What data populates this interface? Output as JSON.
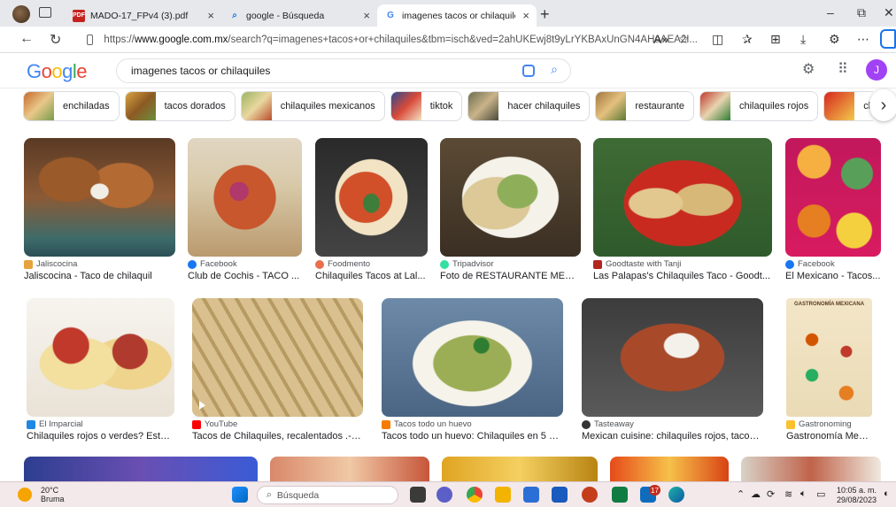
{
  "browser": {
    "tabs": [
      {
        "title": "MADO-17_FPv4 (3).pdf",
        "icon": "pdf-icon",
        "active": false
      },
      {
        "title": "google - Búsqueda",
        "icon": "search-icon",
        "active": false
      },
      {
        "title": "imagenes tacos or chilaquiles - B",
        "icon": "google-icon",
        "active": true
      }
    ],
    "url_prefix": "https://",
    "url_host": "www.google.com.mx",
    "url_rest": "/search?q=imagenes+tacos+or+chilaquiles&tbm=isch&ved=2ahUKEwj8t9yLrYKBAxUnGN4AHaAEA2I...",
    "new_tab": "+",
    "close_glyph": "×",
    "window_controls": {
      "minimize": "–",
      "restore": "⧉",
      "close": "✕"
    }
  },
  "google": {
    "logo": [
      "G",
      "o",
      "o",
      "g",
      "l",
      "e"
    ],
    "query": "imagenes tacos or chilaquiles",
    "avatar_letter": "J"
  },
  "chips": [
    {
      "label": "enchiladas"
    },
    {
      "label": "tacos dorados"
    },
    {
      "label": "chilaquiles mexicanos"
    },
    {
      "label": "tiktok"
    },
    {
      "label": "hacer chilaquiles"
    },
    {
      "label": "restaurante"
    },
    {
      "label": "chilaquiles rojos"
    },
    {
      "label": "cl"
    }
  ],
  "results_row1": [
    {
      "source": "Jaliscocina",
      "caption": "Jaliscocina - Taco de chilaquil"
    },
    {
      "source": "Facebook",
      "caption": "Club de Cochis - TACO ..."
    },
    {
      "source": "Foodmento",
      "caption": "Chilaquiles Tacos at Lal..."
    },
    {
      "source": "Tripadvisor",
      "caption": "Foto de RESTAURANTE MEXIC..."
    },
    {
      "source": "Goodtaste with Tanji",
      "caption": "Las Palapas's Chilaquiles Taco - Goodt..."
    },
    {
      "source": "Facebook",
      "caption": "El Mexicano - Tacos..."
    }
  ],
  "results_row2": [
    {
      "source": "El Imparcial",
      "caption": "Chilaquiles rojos o verdes? Esto ..."
    },
    {
      "source": "YouTube",
      "caption": "Tacos de Chilaquiles, recalentados .- R..."
    },
    {
      "source": "Tacos todo un huevo",
      "caption": "Tacos todo un huevo: Chilaquiles en 5 mi..."
    },
    {
      "source": "Tasteaway",
      "caption": "Mexican cuisine: chilaquiles rojos, tacos ..."
    },
    {
      "source": "Gastronoming",
      "caption": "Gastronomía Mexica..."
    }
  ],
  "poster_title": "GASTRONOMÍA MEXICANA",
  "taskbar": {
    "temp": "20°C",
    "weather": "Bruma",
    "search_placeholder": "Búsqueda",
    "badge": "17",
    "time": "10:05 a. m.",
    "date": "29/08/2023"
  }
}
